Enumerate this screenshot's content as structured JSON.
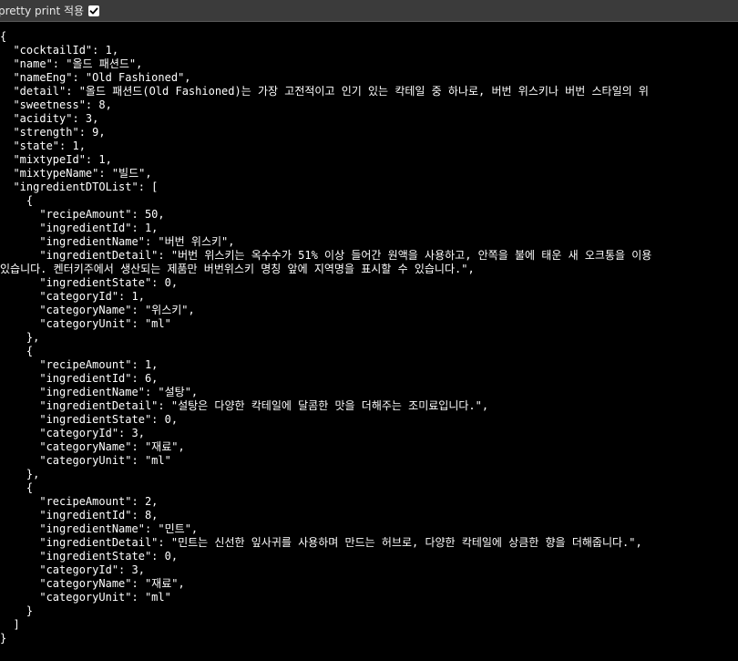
{
  "toolbar": {
    "pretty_print_label": "pretty print 적용",
    "pretty_print_checked": true
  },
  "json_lines": [
    "{",
    "  \"cocktailId\": 1,",
    "  \"name\": \"올드 패션드\",",
    "  \"nameEng\": \"Old Fashioned\",",
    "  \"detail\": \"올드 패션드(Old Fashioned)는 가장 고전적이고 인기 있는 칵테일 중 하나로, 버번 위스키나 버번 스타일의 위",
    "  \"sweetness\": 8,",
    "  \"acidity\": 3,",
    "  \"strength\": 9,",
    "  \"state\": 1,",
    "  \"mixtypeId\": 1,",
    "  \"mixtypeName\": \"빌드\",",
    "  \"ingredientDTOList\": [",
    "    {",
    "      \"recipeAmount\": 50,",
    "      \"ingredientId\": 1,",
    "      \"ingredientName\": \"버번 위스키\",",
    "      \"ingredientDetail\": \"버번 위스키는 옥수수가 51% 이상 들어간 원액을 사용하고, 안쪽을 불에 태운 새 오크통을 이용",
    "있습니다. 켄터키주에서 생산되는 제품만 버번위스키 명칭 앞에 지역명을 표시할 수 있습니다.\",",
    "      \"ingredientState\": 0,",
    "      \"categoryId\": 1,",
    "      \"categoryName\": \"위스키\",",
    "      \"categoryUnit\": \"ml\"",
    "    },",
    "    {",
    "      \"recipeAmount\": 1,",
    "      \"ingredientId\": 6,",
    "      \"ingredientName\": \"설탕\",",
    "      \"ingredientDetail\": \"설탕은 다양한 칵테일에 달콤한 맛을 더해주는 조미료입니다.\",",
    "      \"ingredientState\": 0,",
    "      \"categoryId\": 3,",
    "      \"categoryName\": \"재료\",",
    "      \"categoryUnit\": \"ml\"",
    "    },",
    "    {",
    "      \"recipeAmount\": 2,",
    "      \"ingredientId\": 8,",
    "      \"ingredientName\": \"민트\",",
    "      \"ingredientDetail\": \"민트는 신선한 잎사귀를 사용하며 만드는 허브로, 다양한 칵테일에 상큼한 향을 더해줍니다.\",",
    "      \"ingredientState\": 0,",
    "      \"categoryId\": 3,",
    "      \"categoryName\": \"재료\",",
    "      \"categoryUnit\": \"ml\"",
    "    }",
    "  ]",
    "}"
  ]
}
